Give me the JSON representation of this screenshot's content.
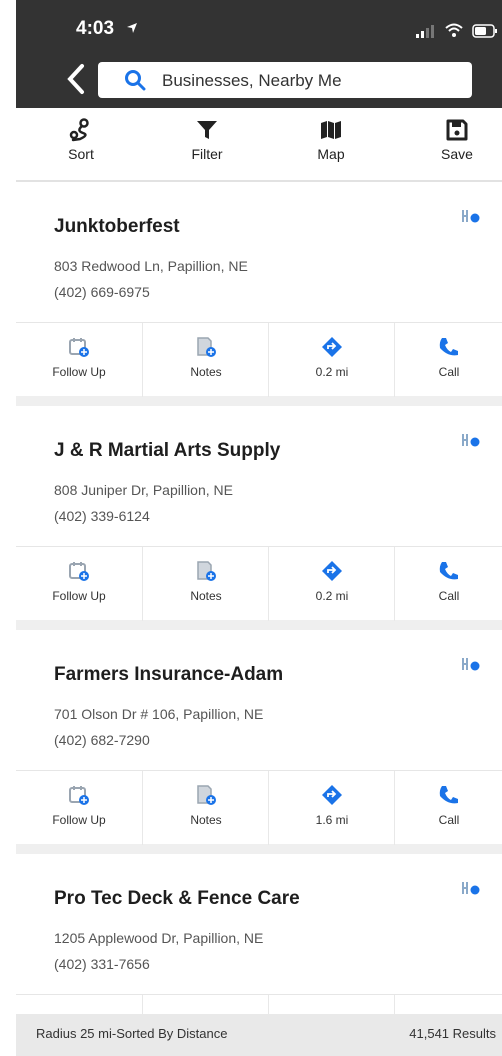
{
  "status_bar": {
    "time": "4:03"
  },
  "search": {
    "text": "Businesses, Nearby Me"
  },
  "toolbar": {
    "items": [
      {
        "label": "Sort",
        "icon": "sort-icon"
      },
      {
        "label": "Filter",
        "icon": "filter-icon"
      },
      {
        "label": "Map",
        "icon": "map-icon"
      },
      {
        "label": "Save",
        "icon": "save-icon"
      }
    ]
  },
  "colors": {
    "accent": "#1a73e8",
    "header_bg": "#333333",
    "list_bg": "#efefef"
  },
  "businesses": [
    {
      "name": "Junktoberfest",
      "address": "803 Redwood Ln, Papillion, NE",
      "phone": "(402) 669-6975",
      "actions": {
        "follow_up": "Follow Up",
        "notes": "Notes",
        "distance": "0.2 mi",
        "call": "Call"
      }
    },
    {
      "name": "J & R Martial Arts Supply",
      "address": "808 Juniper Dr, Papillion, NE",
      "phone": "(402) 339-6124",
      "actions": {
        "follow_up": "Follow Up",
        "notes": "Notes",
        "distance": "0.2 mi",
        "call": "Call"
      }
    },
    {
      "name": "Farmers Insurance-Adam",
      "address": "701 Olson Dr # 106, Papillion, NE",
      "phone": "(402) 682-7290",
      "actions": {
        "follow_up": "Follow Up",
        "notes": "Notes",
        "distance": "1.6 mi",
        "call": "Call"
      }
    },
    {
      "name": "Pro Tec Deck & Fence Care",
      "address": "1205 Applewood Dr, Papillion, NE",
      "phone": "(402) 331-7656"
    }
  ],
  "footer": {
    "radius": "Radius 25 mi-Sorted By Distance",
    "results": "41,541 Results"
  }
}
